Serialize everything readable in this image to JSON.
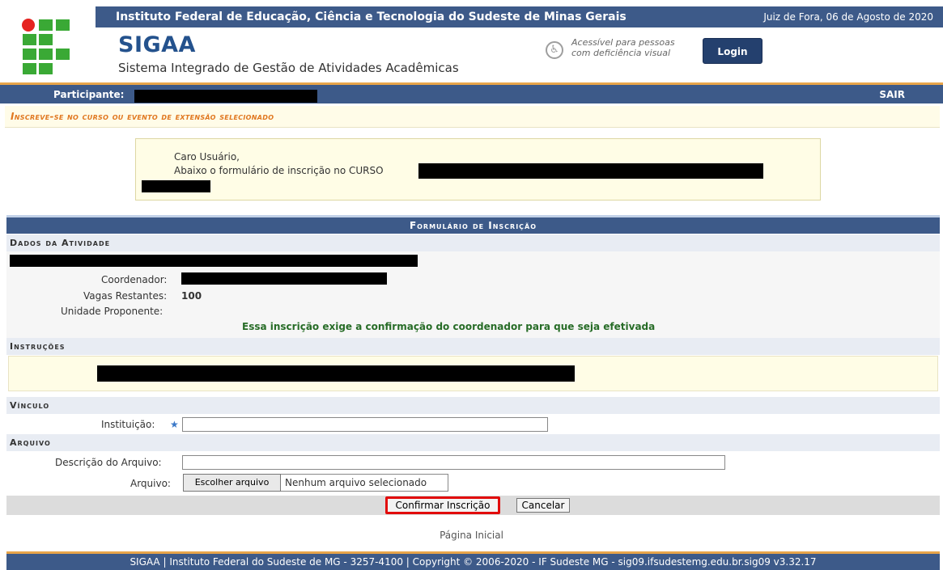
{
  "header": {
    "institution_name": "Instituto Federal de Educação, Ciência e Tecnologia do Sudeste de Minas Gerais",
    "date": "Juiz de Fora, 06 de Agosto de 2020",
    "app_title": "SIGAA",
    "app_subtitle": "Sistema Integrado de Gestão de Atividades Acadêmicas",
    "accessibility_line1": "Acessível para pessoas",
    "accessibility_line2": "com deficiência visual",
    "accessibility_icon": "accessibility-icon",
    "login_label": "Login"
  },
  "participant_bar": {
    "label": "Participante:",
    "logout_label": "SAIR"
  },
  "page_title": "Inscreve-se no curso ou evento de extensão selecionado",
  "message": {
    "line1": "Caro Usuário,",
    "line2": "Abaixo o formulário de inscrição no CURSO"
  },
  "form": {
    "caption": "Formulário de Inscrição",
    "activity_section": {
      "title": "Dados da Atividade",
      "coordinator_label": "Coordenador:",
      "vacancies_label": "Vagas Restantes:",
      "vacancies_value": "100",
      "unit_label": "Unidade Proponente:",
      "notice": "Essa inscrição exige a confirmação do coordenador para que seja efetivada"
    },
    "instructions_section": {
      "title": "Instruções"
    },
    "link_section": {
      "title": "Vínculo",
      "institution_label": "Instituição:",
      "institution_value": ""
    },
    "file_section": {
      "title": "Arquivo",
      "description_label": "Descrição do Arquivo:",
      "description_value": "",
      "file_label": "Arquivo:",
      "choose_file_label": "Escolher arquivo",
      "no_file_label": "Nenhum arquivo selecionado"
    },
    "confirm_label": "Confirmar Inscrição",
    "cancel_label": "Cancelar"
  },
  "home_link": "Página Inicial",
  "footer": "SIGAA | Instituto Federal do Sudeste de MG - 3257-4100 | Copyright © 2006-2020 - IF Sudeste MG - sig09.ifsudestemg.edu.br.sig09 v3.32.17",
  "colors": {
    "primary_blue": "#3d5a89",
    "accent_orange": "#e8a54a",
    "title_orange": "#e0771f",
    "notice_green": "#276c27",
    "highlight_red": "#e20b0b"
  }
}
